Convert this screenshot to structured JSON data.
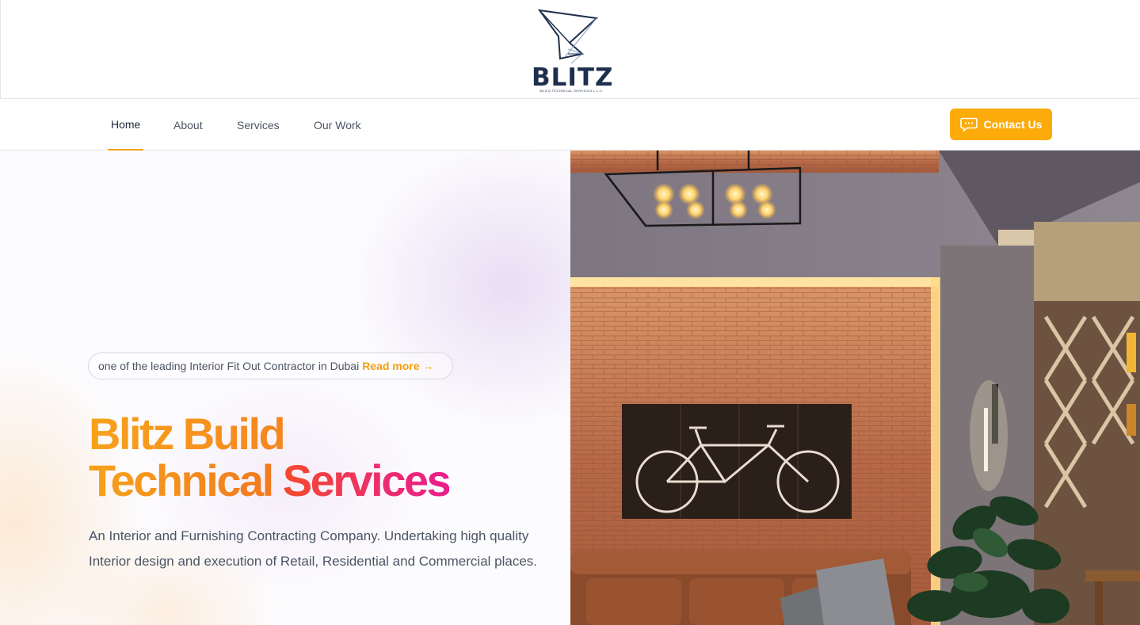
{
  "brand": {
    "name": "BLITZ",
    "tagline": "BUILD TECHNICAL SERVICES L.L.C",
    "logo_icon": "blitz-logo-mark"
  },
  "nav": {
    "items": [
      {
        "label": "Home",
        "active": true
      },
      {
        "label": "About",
        "active": false
      },
      {
        "label": "Services",
        "active": false
      },
      {
        "label": "Our Work",
        "active": false
      }
    ],
    "contact_button": {
      "label": "Contact Us",
      "icon": "chat-bubble-icon"
    }
  },
  "hero": {
    "badge_text": "one of the leading Interior Fit Out Contractor in Dubai",
    "badge_link": "Read more →",
    "title_line1": "Blitz Build",
    "title_line2_part1": "Technical",
    "title_line2_part2": "Services",
    "description": "An Interior and Furnishing Contracting Company. Undertaking high quality Interior design and execution of Retail, Residential and Commercial places.",
    "image": "interior-lounge-photo"
  },
  "colors": {
    "accent": "#fcab0a",
    "title_orange": "#f7a21b",
    "title_pink": "#e91e8c",
    "brand_navy": "#1e2f4d"
  }
}
